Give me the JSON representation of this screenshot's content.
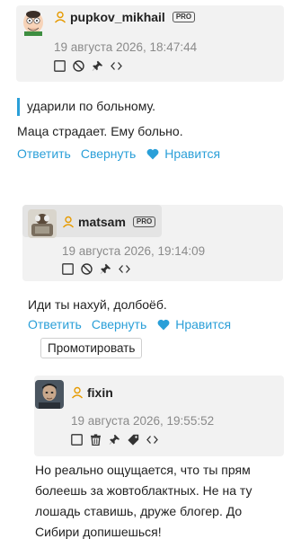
{
  "comments": [
    {
      "username": "pupkov_mikhail",
      "badge": "PRO",
      "timestamp": "19 августа 2026, 18:47:44",
      "quote": "ударили по больному.",
      "body": "Маца страдает. Ему больно.",
      "actions": {
        "reply": "Ответить",
        "collapse": "Свернуть",
        "like": "Нравится"
      }
    },
    {
      "username": "matsam",
      "badge": "PRO",
      "timestamp": "19 августа 2026, 19:14:09",
      "body": "Иди ты нахуй, долбоёб.",
      "actions": {
        "reply": "Ответить",
        "collapse": "Свернуть",
        "like": "Нравится"
      },
      "promote": "Промотировать"
    },
    {
      "username": "fixin",
      "timestamp": "19 августа 2026, 19:55:52",
      "body_lines": [
        "Но реально ощущается, что ты прям",
        "болеешь за жовтоблактных. Не на ту",
        "лошадь ставишь, друже блогер. До",
        "Сибири допишешься!"
      ]
    }
  ],
  "icons": {
    "checkbox": "checkbox-icon",
    "block": "block-icon",
    "pin": "pin-icon",
    "code": "code-icon",
    "trash": "trash-icon",
    "tag": "tag-icon",
    "user": "user-icon",
    "heart": "heart-icon"
  },
  "colors": {
    "accent": "#2a9fd8",
    "header_bg": "#f2f2f2",
    "meta_text": "#8a8a8a"
  }
}
